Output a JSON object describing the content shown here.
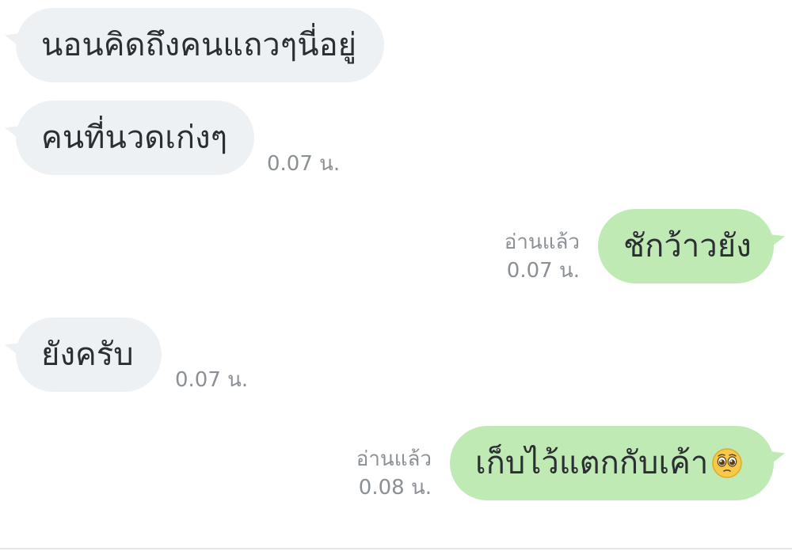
{
  "messages": [
    {
      "side": "in",
      "text": "นอนคิดถึงคนแถวๆนี่อยู่",
      "time": ""
    },
    {
      "side": "in",
      "text": "คนที่นวดเก่งๆ",
      "time": "0.07 น."
    },
    {
      "side": "out",
      "text": "ชักว้าวยัง",
      "read": "อ่านแล้ว",
      "time": "0.07 น."
    },
    {
      "side": "in",
      "text": "ยังครับ",
      "time": "0.07 น."
    },
    {
      "side": "out",
      "text": "เก็บไว้แตกกับเค้า",
      "emoji": "pleading-face-icon",
      "read": "อ่านแล้ว",
      "time": "0.08 น."
    }
  ],
  "colors": {
    "incoming_bubble": "#edf1f3",
    "outgoing_bubble": "#bfeab4",
    "text": "#2b2f33",
    "meta": "#8a9095"
  }
}
